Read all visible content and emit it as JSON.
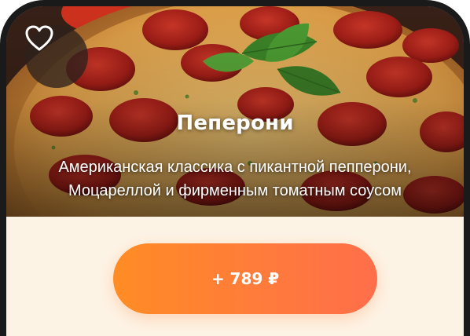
{
  "product": {
    "name": "Пеперони",
    "description_line1": "Американская классика с пикантной пепперони,",
    "description_line2": "Моцареллой и фирменным томатным соусом",
    "image_icon": "pizza-image"
  },
  "favorite": {
    "icon": "heart-outline-icon"
  },
  "cart": {
    "price_label": "+ 789 ₽"
  },
  "colors": {
    "accent_start": "#ff8c24",
    "accent_end": "#ff6e4a",
    "panel_background": "#fdf3e4",
    "frame": "#1a1a1a"
  }
}
